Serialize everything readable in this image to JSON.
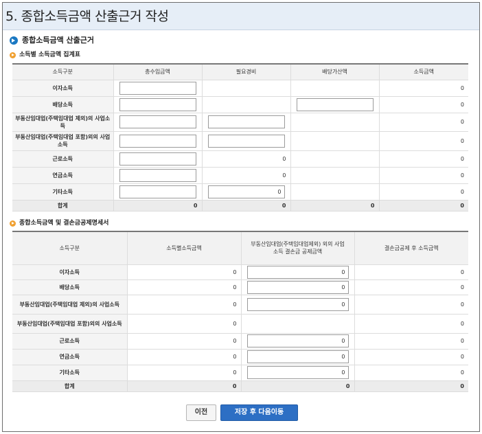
{
  "page_title": "5. 종합소득금액 산출근거 작성",
  "section_title": "종합소득금액 산출근거",
  "table1": {
    "title": "소득별 소득금액 집계표",
    "columns": [
      "소득구분",
      "총수입금액",
      "필요경비",
      "배당가산액",
      "소득금액"
    ],
    "rows": [
      {
        "label": "이자소득",
        "income_input": "",
        "expense": "",
        "dividend_input": null,
        "amount": "0"
      },
      {
        "label": "배당소득",
        "income_input": "",
        "expense": "",
        "dividend_input": "",
        "amount": "0"
      },
      {
        "label": "부동산임대업(주택임대업 제외)의 사업소득",
        "income_input": "",
        "expense_input": "",
        "amount": "0"
      },
      {
        "label": "부동산임대업(주택임대업 포함)외의 사업소득",
        "income_input": "",
        "expense_input": "",
        "amount": "0"
      },
      {
        "label": "근로소득",
        "income_input": "",
        "expense": "0",
        "amount": "0"
      },
      {
        "label": "연금소득",
        "income_input": "",
        "expense": "0",
        "amount": "0"
      },
      {
        "label": "기타소득",
        "income_input": "",
        "expense_input": "0",
        "amount": "0"
      }
    ],
    "total": {
      "label": "합계",
      "income": "0",
      "expense": "0",
      "dividend": "0",
      "amount": "0"
    }
  },
  "table2": {
    "title": "종합소득금액 및 결손금공제명세서",
    "columns": [
      "소득구분",
      "소득별소득금액",
      "부동산임대업(주택임대업제외) 외의 사업소득 결손금 공제금액",
      "결손금공제 후 소득금액"
    ],
    "rows": [
      {
        "label": "이자소득",
        "amount": "0",
        "deduction_input": "0",
        "after": "0"
      },
      {
        "label": "배당소득",
        "amount": "0",
        "deduction_input": "0",
        "after": "0"
      },
      {
        "label": "부동산임대업(주택임대업 제외)의 사업소득",
        "amount": "0",
        "deduction_input": "0",
        "after": "0"
      },
      {
        "label": "부동산임대업(주택임대업 포함)외의 사업소득",
        "amount": "0",
        "deduction_input": null,
        "after": "0"
      },
      {
        "label": "근로소득",
        "amount": "0",
        "deduction_input": "0",
        "after": "0"
      },
      {
        "label": "연금소득",
        "amount": "0",
        "deduction_input": "0",
        "after": "0"
      },
      {
        "label": "기타소득",
        "amount": "0",
        "deduction_input": "0",
        "after": "0"
      }
    ],
    "total": {
      "label": "합계",
      "amount": "0",
      "deduction": "0",
      "after": "0"
    }
  },
  "buttons": {
    "prev": "이전",
    "next": "저장 후 다음이동"
  }
}
